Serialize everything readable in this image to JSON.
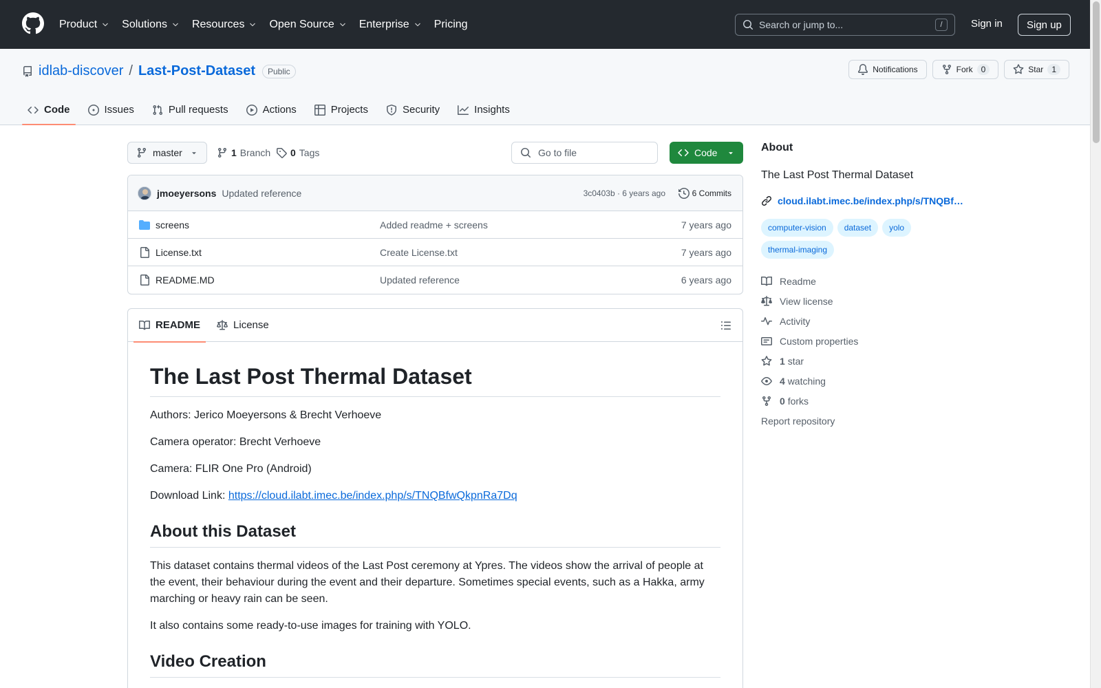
{
  "header": {
    "nav": [
      "Product",
      "Solutions",
      "Resources",
      "Open Source",
      "Enterprise",
      "Pricing"
    ],
    "search_placeholder": "Search or jump to...",
    "search_key": "/",
    "signin": "Sign in",
    "signup": "Sign up"
  },
  "repo": {
    "owner": "idlab-discover",
    "separator": "/",
    "name": "Last-Post-Dataset",
    "visibility": "Public",
    "notifications_label": "Notifications",
    "fork_label": "Fork",
    "fork_count": "0",
    "star_label": "Star",
    "star_count": "1"
  },
  "tabs": [
    "Code",
    "Issues",
    "Pull requests",
    "Actions",
    "Projects",
    "Security",
    "Insights"
  ],
  "toolbar": {
    "branch": "master",
    "branch_count": "1",
    "branch_label": "Branch",
    "tag_count": "0",
    "tag_label": "Tags",
    "goto_placeholder": "Go to file",
    "code_label": "Code"
  },
  "commit": {
    "user": "jmoeyersons",
    "message": "Updated reference",
    "meta": "3c0403b · 6 years ago",
    "commits_label": "6 Commits"
  },
  "files": [
    {
      "name": "screens",
      "type": "folder",
      "message": "Added readme + screens",
      "age": "7 years ago"
    },
    {
      "name": "License.txt",
      "type": "file",
      "message": "Create License.txt",
      "age": "7 years ago"
    },
    {
      "name": "README.MD",
      "type": "file",
      "message": "Updated reference",
      "age": "6 years ago"
    }
  ],
  "readme": {
    "tab_readme": "README",
    "tab_license": "License",
    "title": "The Last Post Thermal Dataset",
    "authors": "Authors: Jerico Moeyersons & Brecht Verhoeve",
    "operator": "Camera operator: Brecht Verhoeve",
    "camera": "Camera: FLIR One Pro (Android)",
    "download_prefix": "Download Link: ",
    "download_link": "https://cloud.ilabt.imec.be/index.php/s/TNQBfwQkpnRa7Dq",
    "h2_about": "About this Dataset",
    "about_p1": "This dataset contains thermal videos of the Last Post ceremony at Ypres. The videos show the arrival of people at the event, their behaviour during the event and their departure. Sometimes special events, such as a Hakka, army marching or heavy rain can be seen.",
    "about_p2": "It also contains some ready-to-use images for training with YOLO.",
    "h2_video": "Video Creation"
  },
  "about": {
    "heading": "About",
    "description": "The Last Post Thermal Dataset",
    "website": "cloud.ilabt.imec.be/index.php/s/TNQBf…",
    "topics": [
      "computer-vision",
      "dataset",
      "yolo",
      "thermal-imaging"
    ],
    "readme": "Readme",
    "license": "View license",
    "activity": "Activity",
    "custom": "Custom properties",
    "stars_count": "1",
    "stars_label": "star",
    "watch_count": "4",
    "watch_label": "watching",
    "forks_count": "0",
    "forks_label": "forks",
    "report": "Report repository"
  },
  "colors": {
    "header_bg": "#24292f",
    "link": "#0969da",
    "primary_button": "#1f883d",
    "tab_underline": "#fd8c73",
    "topic_bg": "#ddf4ff"
  }
}
